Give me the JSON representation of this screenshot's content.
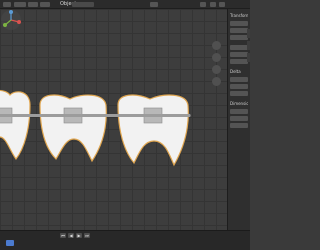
{
  "header": {
    "mode_label": "Object"
  },
  "colors": {
    "tooth_fill": "#f2f2f2",
    "tooth_outline": "#e0a650",
    "bracket": "#b8b8b8",
    "wire": "#9c9c9c"
  },
  "viewport": {
    "teeth": 3,
    "brackets": 3
  },
  "gizmo": {
    "icons": [
      "axis-gizmo-icon",
      "zoom-icon",
      "pan-icon",
      "camera-icon",
      "grid-icon"
    ]
  },
  "timeline": {
    "controls": [
      "⏮",
      "◀",
      "▶",
      "⏭"
    ]
  },
  "sidebar": {
    "sections": [
      "Transform",
      "Delta",
      "Dimensions"
    ]
  }
}
